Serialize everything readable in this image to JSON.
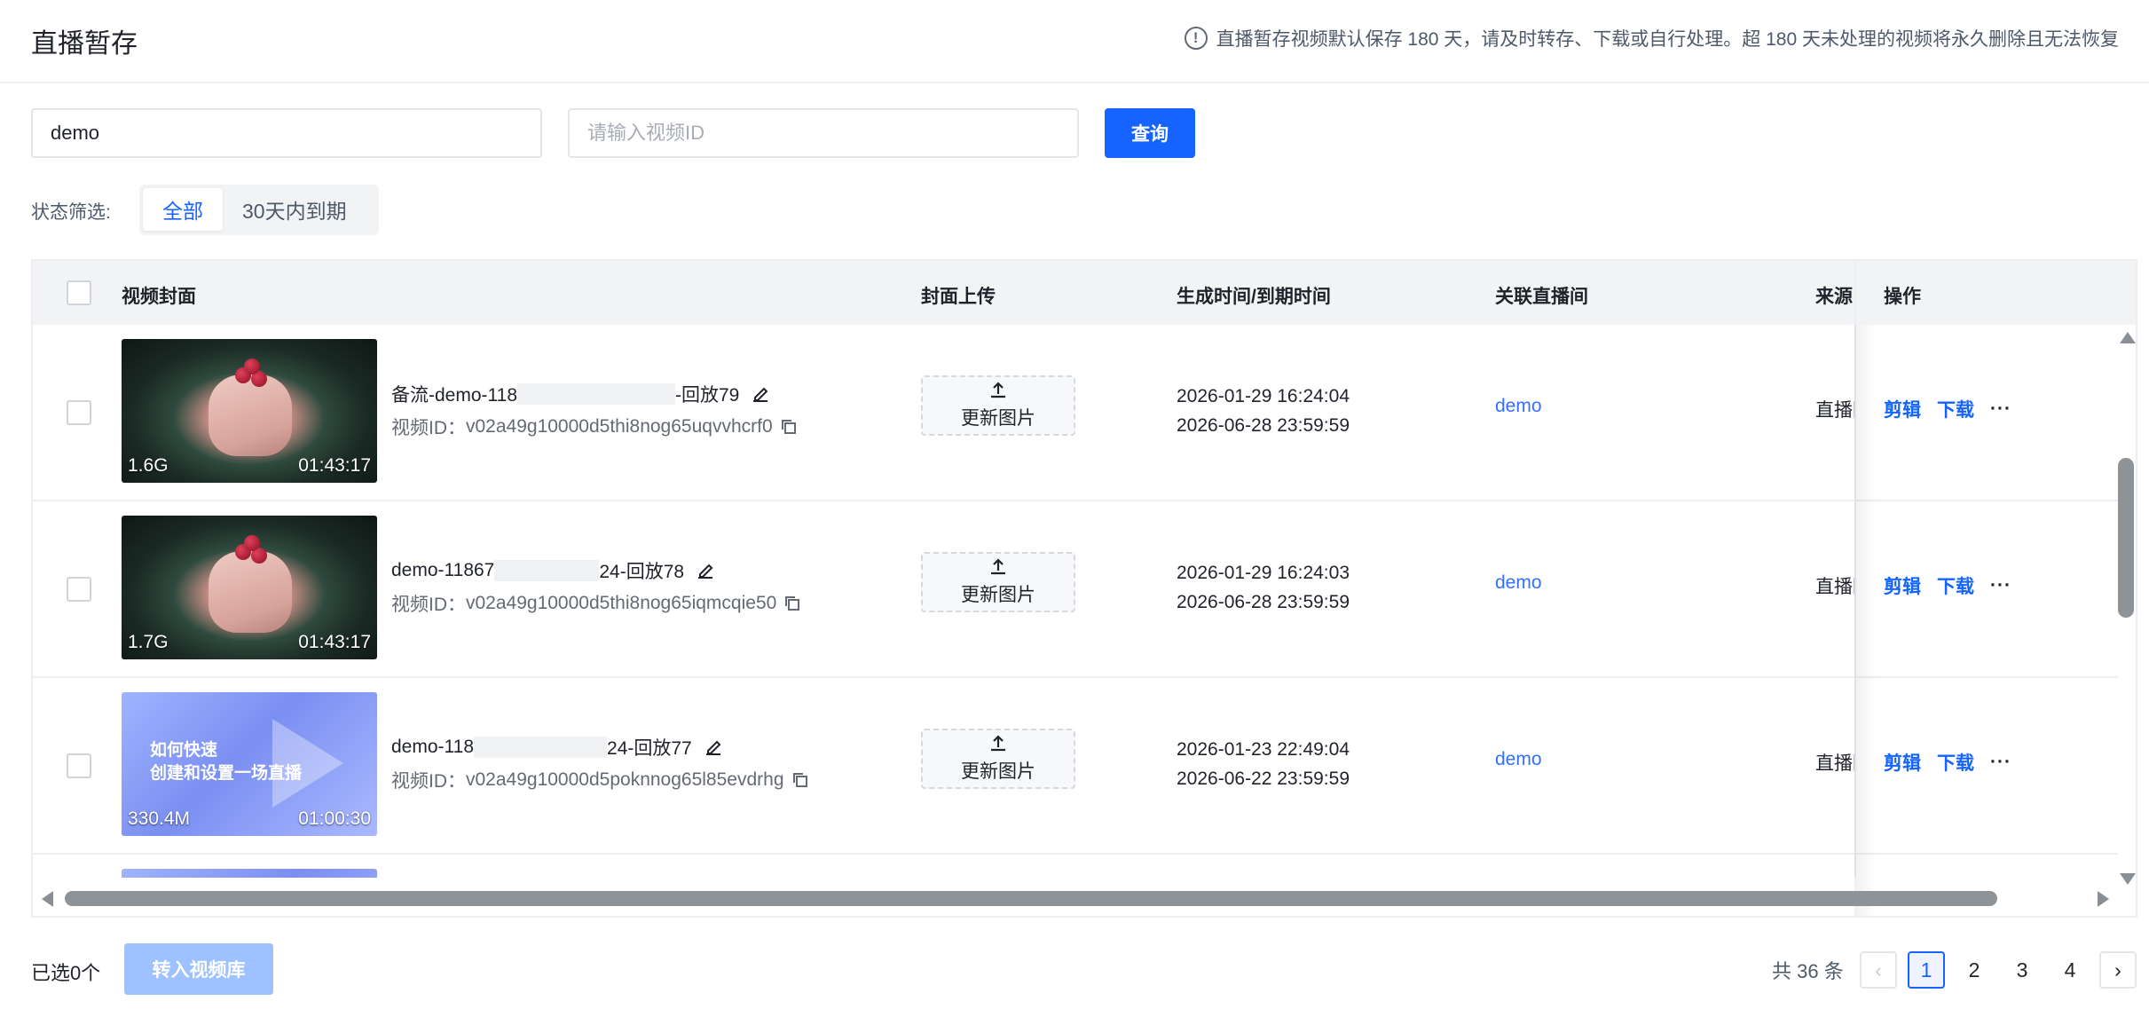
{
  "header": {
    "title": "直播暂存",
    "notice": "直播暂存视频默认保存 180 天，请及时转存、下载或自行处理。超 180 天未处理的视频将永久删除且无法恢复"
  },
  "search": {
    "name_value": "demo",
    "id_placeholder": "请输入视频ID",
    "query_label": "查询"
  },
  "filter": {
    "label": "状态筛选:",
    "options": [
      "全部",
      "30天内到期"
    ],
    "selected": "全部"
  },
  "table": {
    "columns": [
      "视频封面",
      "封面上传",
      "生成时间/到期时间",
      "关联直播间",
      "来源",
      "操作"
    ],
    "upload_label": "更新图片",
    "actions": {
      "edit": "剪辑",
      "download": "下载",
      "more": "···"
    },
    "vid_prefix": "视频ID：",
    "rows": [
      {
        "thumb": "cake",
        "size": "1.6G",
        "duration": "01:43:17",
        "title_prefix": "备流-demo-118",
        "title_suffix": "-回放79",
        "video_id": "v02a49g10000d5thi8nog65uqvvhcrf0",
        "created": "2026-01-29 16:24:04",
        "expires": "2026-06-28 23:59:59",
        "room": "demo",
        "source": "直播回放"
      },
      {
        "thumb": "cake",
        "size": "1.7G",
        "duration": "01:43:17",
        "title_prefix": "demo-11867",
        "title_suffix": "24-回放78",
        "video_id": "v02a49g10000d5thi8nog65iqmcqie50",
        "created": "2026-01-29 16:24:03",
        "expires": "2026-06-28 23:59:59",
        "room": "demo",
        "source": "直播回放"
      },
      {
        "thumb": "promo",
        "size": "330.4M",
        "duration": "01:00:30",
        "title_prefix": "demo-118",
        "title_suffix": "24-回放77",
        "video_id": "v02a49g10000d5poknnog65l85evdrhg",
        "created": "2026-01-23 22:49:04",
        "expires": "2026-06-22 23:59:59",
        "room": "demo",
        "source": "直播回放",
        "promo_line1": "如何快速",
        "promo_line2": "创建和设置一场直播"
      }
    ]
  },
  "footer": {
    "selected": "已选0个",
    "move_label": "转入视频库",
    "total": "共 36 条",
    "pages": [
      "1",
      "2",
      "3",
      "4"
    ],
    "current_page": "1",
    "prev": "‹",
    "next": "›"
  },
  "colors": {
    "primary": "#1664ff",
    "link": "#3370ff",
    "disabled_btn": "#9ec2ff"
  }
}
